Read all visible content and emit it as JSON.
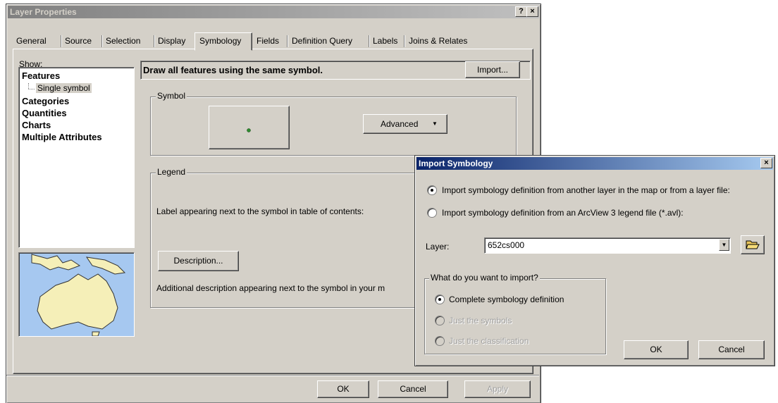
{
  "layer_properties": {
    "title": "Layer Properties",
    "help_btn": "?",
    "close_btn": "×",
    "tabs": [
      "General",
      "Source",
      "Selection",
      "Display",
      "Symbology",
      "Fields",
      "Definition Query",
      "Labels",
      "Joins & Relates"
    ],
    "active_tab": "Symbology",
    "show_label": "Show:",
    "tree": {
      "features": "Features",
      "single_symbol": "Single symbol",
      "categories": "Categories",
      "quantities": "Quantities",
      "charts": "Charts",
      "multiple_attributes": "Multiple Attributes"
    },
    "heading": "Draw all features using the same symbol.",
    "import_btn": "Import...",
    "symbol_group": "Symbol",
    "advanced_btn": "Advanced",
    "legend_group": "Legend",
    "legend_label_text": "Label appearing next to the symbol in table of contents:",
    "description_btn": "Description...",
    "description_text": "Additional description appearing next to the symbol in your m",
    "ok_btn": "OK",
    "cancel_btn": "Cancel",
    "apply_btn": "Apply"
  },
  "import_symbology": {
    "title": "Import Symbology",
    "close_btn": "×",
    "option_layer": "Import symbology definition from another layer in the map or from a layer file:",
    "option_avl": "Import symbology definition from an ArcView 3 legend file (*.avl):",
    "selected_option": "layer",
    "layer_label": "Layer:",
    "layer_value": "652cs000",
    "what_group": "What do you want to import?",
    "import_options": [
      "Complete symbology definition",
      "Just the symbols",
      "Just the classification"
    ],
    "selected_import": "Complete symbology definition",
    "ok_btn": "OK",
    "cancel_btn": "Cancel"
  },
  "colors": {
    "titlebar_active": "#0a246a",
    "titlebar_inactive": "#808080",
    "dialog_face": "#d4d0c8",
    "map_water": "#a6c8f0",
    "map_land": "#f5efb8",
    "symbol_point": "#2e8b2e"
  }
}
